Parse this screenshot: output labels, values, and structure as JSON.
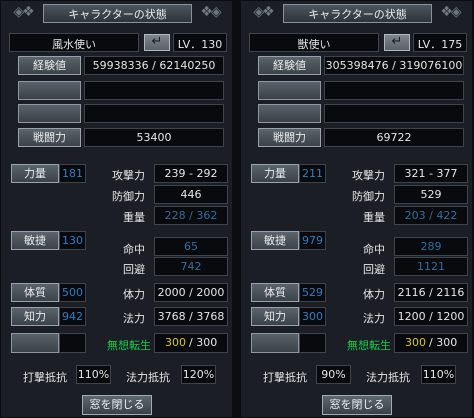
{
  "left": {
    "title": "キャラクターの状態",
    "class_name": "風水使い",
    "level": "LV．130",
    "exp_label": "経験値",
    "exp_value": "59938336 / 62140250",
    "combat_label": "戦闘力",
    "combat_value": "53400",
    "str_label": "力量",
    "str_value": "181",
    "atk_label": "攻撃力",
    "atk_value": "239 - 292",
    "def_label": "防御力",
    "def_value": "446",
    "weight_label": "重量",
    "weight_value": "228 / 362",
    "agi_label": "敏捷",
    "agi_value": "130",
    "hit_label": "命中",
    "hit_value": "65",
    "eva_label": "回避",
    "eva_value": "742",
    "vit_label": "体質",
    "vit_value": "500",
    "hp_label": "体力",
    "hp_value": "2000 / 2000",
    "int_label": "知力",
    "int_value": "942",
    "mp_label": "法力",
    "mp_value": "3768 / 3768",
    "reincarnation_label": "無想転生",
    "reincarnation_current": "300",
    "reincarnation_max": "/ 300",
    "phys_res_label": "打撃抵抗",
    "phys_res_value": "110%",
    "magic_res_label": "法力抵抗",
    "magic_res_value": "120%",
    "close_label": "窓を閉じる"
  },
  "right": {
    "title": "キャラクターの状態",
    "class_name": "獣使い",
    "level": "LV．175",
    "exp_label": "経験値",
    "exp_value": "305398476 / 319076100",
    "combat_label": "戦闘力",
    "combat_value": "69722",
    "str_label": "力量",
    "str_value": "211",
    "atk_label": "攻撃力",
    "atk_value": "321 - 377",
    "def_label": "防御力",
    "def_value": "529",
    "weight_label": "重量",
    "weight_value": "203 / 422",
    "agi_label": "敏捷",
    "agi_value": "979",
    "hit_label": "命中",
    "hit_value": "289",
    "eva_label": "回避",
    "eva_value": "1121",
    "vit_label": "体質",
    "vit_value": "529",
    "hp_label": "体力",
    "hp_value": "2116 / 2116",
    "int_label": "知力",
    "int_value": "300",
    "mp_label": "法力",
    "mp_value": "1200 / 1200",
    "reincarnation_label": "無想転生",
    "reincarnation_current": "300",
    "reincarnation_max": "/ 300",
    "phys_res_label": "打撃抵抗",
    "phys_res_value": "90%",
    "magic_res_label": "法力抵抗",
    "magic_res_value": "110%",
    "close_label": "窓を閉じる"
  },
  "icons": {
    "return": "return-arrow-icon",
    "ornament": "celtic-knot-icon"
  },
  "colors": {
    "label_blue": "#2d7fc4",
    "muted_value": "#2f6f9e",
    "reincarnation_green": "#17c84a",
    "reincarnation_yellow": "#d6c41c"
  }
}
